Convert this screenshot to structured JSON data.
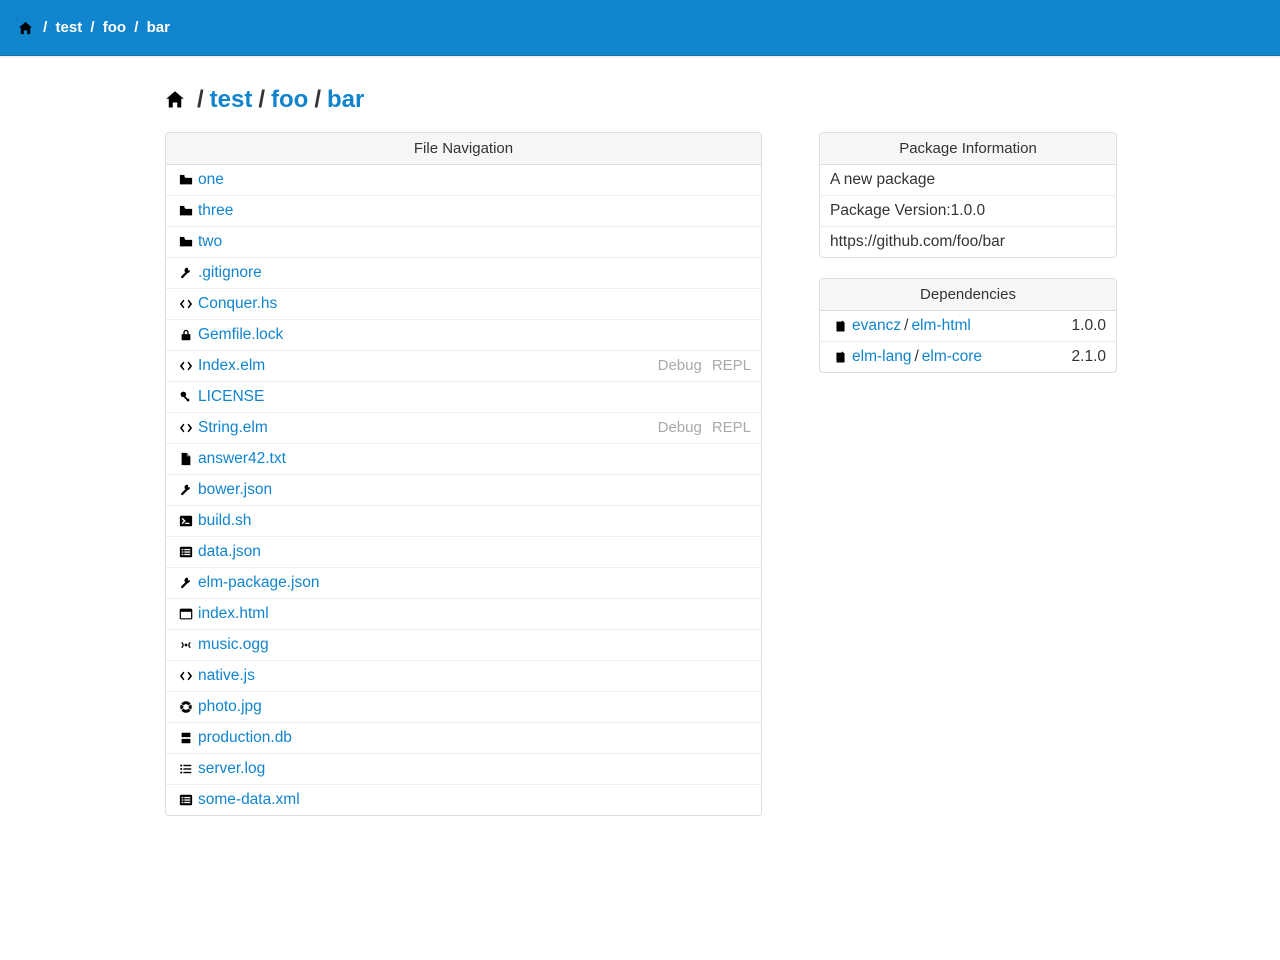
{
  "breadcrumbs": [
    "test",
    "foo",
    "bar"
  ],
  "panels": {
    "file_nav_title": "File Navigation",
    "pkg_info_title": "Package Information",
    "deps_title": "Dependencies"
  },
  "pkg_info": {
    "description": "A new package",
    "version_label": "Package Version: ",
    "version": "1.0.0",
    "repo_url": "https://github.com/foo/bar"
  },
  "actions": {
    "debug": "Debug",
    "repl": "REPL"
  },
  "files": [
    {
      "name": "one",
      "icon": "folder",
      "elm": false
    },
    {
      "name": "three",
      "icon": "folder",
      "elm": false
    },
    {
      "name": "two",
      "icon": "folder",
      "elm": false
    },
    {
      "name": ".gitignore",
      "icon": "wrench",
      "elm": false
    },
    {
      "name": "Conquer.hs",
      "icon": "code",
      "elm": false
    },
    {
      "name": "Gemfile.lock",
      "icon": "lock",
      "elm": false
    },
    {
      "name": "Index.elm",
      "icon": "code",
      "elm": true
    },
    {
      "name": "LICENSE",
      "icon": "key",
      "elm": false
    },
    {
      "name": "String.elm",
      "icon": "code",
      "elm": true
    },
    {
      "name": "answer42.txt",
      "icon": "file",
      "elm": false
    },
    {
      "name": "bower.json",
      "icon": "wrench",
      "elm": false
    },
    {
      "name": "build.sh",
      "icon": "terminal",
      "elm": false
    },
    {
      "name": "data.json",
      "icon": "listalt",
      "elm": false
    },
    {
      "name": "elm-package.json",
      "icon": "wrench",
      "elm": false
    },
    {
      "name": "index.html",
      "icon": "window",
      "elm": false
    },
    {
      "name": "music.ogg",
      "icon": "audio",
      "elm": false
    },
    {
      "name": "native.js",
      "icon": "code",
      "elm": false
    },
    {
      "name": "photo.jpg",
      "icon": "image",
      "elm": false
    },
    {
      "name": "production.db",
      "icon": "database",
      "elm": false
    },
    {
      "name": "server.log",
      "icon": "list",
      "elm": false
    },
    {
      "name": "some-data.xml",
      "icon": "listalt",
      "elm": false
    }
  ],
  "dependencies": [
    {
      "user": "evancz",
      "repo": "elm-html",
      "version": "1.0.0"
    },
    {
      "user": "elm-lang",
      "repo": "elm-core",
      "version": "2.1.0"
    }
  ]
}
